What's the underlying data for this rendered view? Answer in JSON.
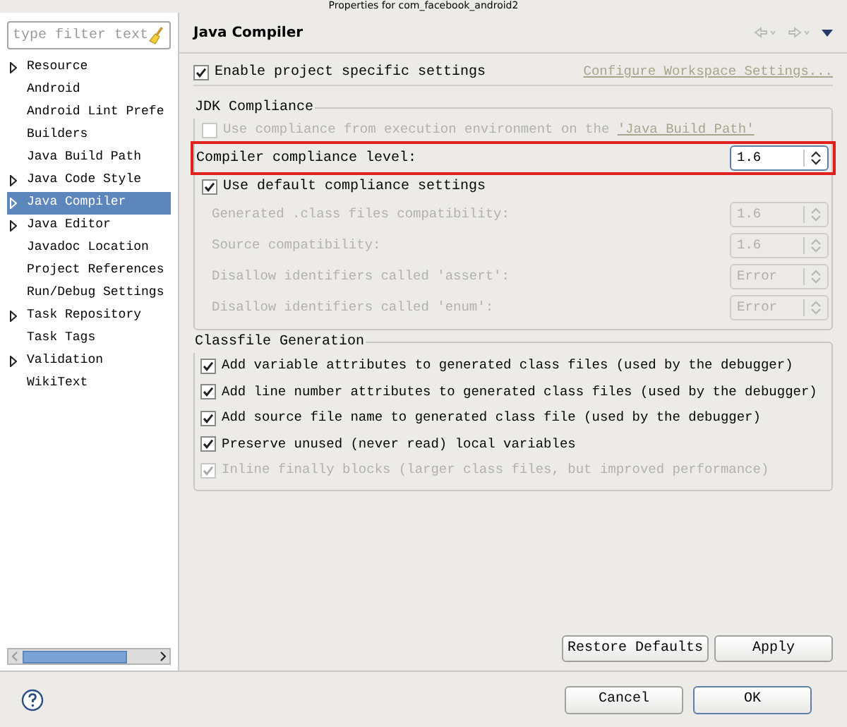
{
  "window": {
    "title": "Properties for com_facebook_android2"
  },
  "sidebar": {
    "filter": {
      "placeholder": "type filter text"
    },
    "items": [
      {
        "label": "Resource",
        "expandable": true,
        "selected": false
      },
      {
        "label": "Android",
        "expandable": false,
        "selected": false
      },
      {
        "label": "Android Lint Prefe",
        "expandable": false,
        "selected": false
      },
      {
        "label": "Builders",
        "expandable": false,
        "selected": false
      },
      {
        "label": "Java Build Path",
        "expandable": false,
        "selected": false
      },
      {
        "label": "Java Code Style",
        "expandable": true,
        "selected": false
      },
      {
        "label": "Java Compiler",
        "expandable": true,
        "selected": true
      },
      {
        "label": "Java Editor",
        "expandable": true,
        "selected": false
      },
      {
        "label": "Javadoc Location",
        "expandable": false,
        "selected": false
      },
      {
        "label": "Project References",
        "expandable": false,
        "selected": false
      },
      {
        "label": "Run/Debug Settings",
        "expandable": false,
        "selected": false
      },
      {
        "label": "Task Repository",
        "expandable": true,
        "selected": false
      },
      {
        "label": "Task Tags",
        "expandable": false,
        "selected": false
      },
      {
        "label": "Validation",
        "expandable": true,
        "selected": false
      },
      {
        "label": "WikiText",
        "expandable": false,
        "selected": false
      }
    ]
  },
  "page": {
    "title": "Java Compiler",
    "enable_specific": {
      "label": "Enable project specific settings",
      "checked": true
    },
    "configure_link": "Configure Workspace Settings...",
    "jdk_compliance": {
      "title": "JDK Compliance",
      "use_ee": {
        "label": "Use compliance from execution environment on the ",
        "link": "'Java Build Path'",
        "checked": false,
        "disabled": true
      },
      "compliance_level": {
        "label": "Compiler compliance level:",
        "value": "1.6",
        "highlighted": true
      },
      "use_default": {
        "label": "Use default compliance settings",
        "checked": true
      },
      "settings": [
        {
          "label": "Generated .class files compatibility:",
          "value": "1.6",
          "disabled": true
        },
        {
          "label": "Source compatibility:",
          "value": "1.6",
          "disabled": true
        },
        {
          "label": "Disallow identifiers called 'assert':",
          "value": "Error",
          "disabled": true
        },
        {
          "label": "Disallow identifiers called 'enum':",
          "value": "Error",
          "disabled": true
        }
      ]
    },
    "classfile_generation": {
      "title": "Classfile Generation",
      "options": [
        {
          "label": "Add variable attributes to generated class files (used by the debugger)",
          "checked": true,
          "disabled": false
        },
        {
          "label": "Add line number attributes to generated class files (used by the debugger)",
          "checked": true,
          "disabled": false
        },
        {
          "label": "Add source file name to generated class file (used by the debugger)",
          "checked": true,
          "disabled": false
        },
        {
          "label": "Preserve unused (never read) local variables",
          "checked": true,
          "disabled": false
        },
        {
          "label": "Inline finally blocks (larger class files, but improved performance)",
          "checked": true,
          "disabled": true
        }
      ]
    },
    "buttons": [
      "Restore Defaults",
      "Apply"
    ]
  },
  "footer": {
    "buttons": [
      {
        "label": "Cancel",
        "default": false
      },
      {
        "label": "OK",
        "default": true
      }
    ]
  }
}
